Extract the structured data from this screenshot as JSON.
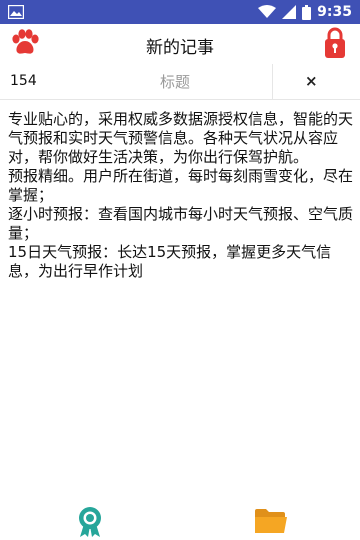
{
  "status_bar": {
    "time": "9:35",
    "icons": [
      "image-icon",
      "wifi-icon",
      "signal-icon",
      "battery-icon"
    ]
  },
  "app_bar": {
    "title": "新的记事",
    "left_icon": "paw-icon",
    "right_icon": "lock-icon"
  },
  "editor": {
    "char_count": "154",
    "title_placeholder": "标题",
    "title_value": "",
    "clear_label": "×",
    "body": "专业贴心的，采用权威多数据源授权信息，智能的天气预报和实时天气预警信息。各种天气状况从容应对，帮你做好生活决策，为你出行保驾护航。\n预报精细。用户所在街道，每时每刻雨雪变化，尽在掌握；\n逐小时预报：查看国内城市每小时天气预报、空气质量；\n15日天气预报：长达15天预报，掌握更多天气信息，为出行早作计划"
  },
  "bottom_bar": {
    "left_icon": "award-icon",
    "right_icon": "folder-icon"
  },
  "colors": {
    "status_bar": "#3f51b5",
    "accent_red": "#e53935",
    "award_teal": "#26a69a",
    "folder_orange": "#f5a623"
  }
}
